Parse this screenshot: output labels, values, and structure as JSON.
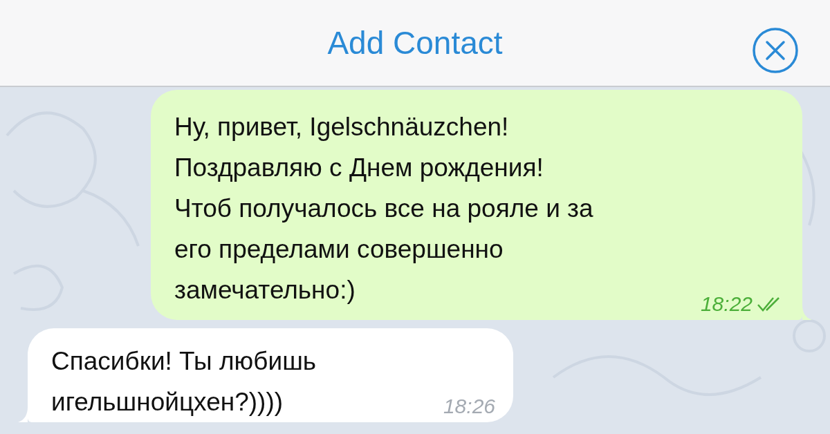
{
  "header": {
    "title": "Add Contact"
  },
  "messages": [
    {
      "kind": "outgoing",
      "text": "Ну, привет, Igelschnäuzchen!\nПоздравляю с Днем рождения!\nЧтоб получалось все на рояле и за\nего пределами совершенно\nзамечательно:)",
      "time": "18:22",
      "read": true
    },
    {
      "kind": "incoming",
      "text": "Спасибки! Ты любишь\nигельшнойцхен?))))",
      "time": "18:26"
    }
  ]
}
